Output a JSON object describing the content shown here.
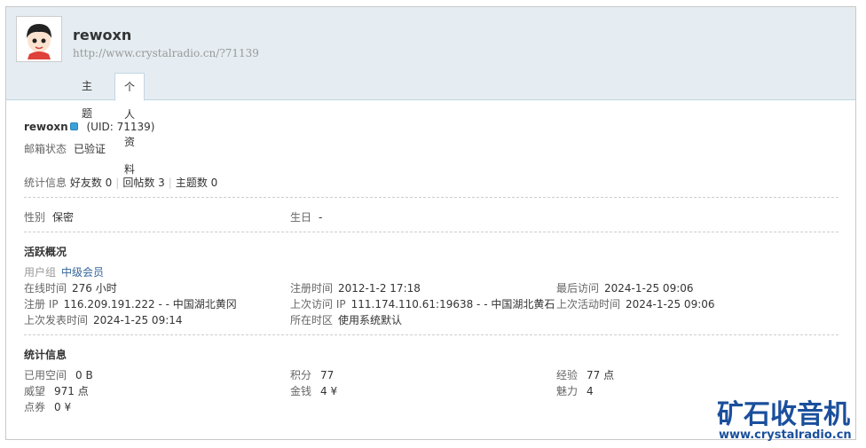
{
  "profile": {
    "username": "rewoxn",
    "url": "http://www.crystalradio.cn/?71139",
    "uid_text": "(UID: 71139)"
  },
  "tabs": [
    {
      "label": "主题"
    },
    {
      "label": "个人资料"
    }
  ],
  "basic": {
    "email_status_label": "邮箱状态",
    "email_status_value": "已验证",
    "stats_label": "统计信息",
    "friends": "好友数 0",
    "replies": "回帖数 3",
    "threads": "主题数 0",
    "gender_label": "性别",
    "gender_value": "保密",
    "birthday_label": "生日",
    "birthday_value": "-"
  },
  "activity": {
    "title": "活跃概况",
    "usergroup_label": "用户组",
    "usergroup_value": "中级会员",
    "online_label": "在线时间",
    "online_value": "276 小时",
    "reg_time_label": "注册时间",
    "reg_time_value": "2012-1-2 17:18",
    "last_visit_label": "最后访问",
    "last_visit_value": "2024-1-25 09:06",
    "reg_ip_label": "注册 IP",
    "reg_ip_value": "116.209.191.222 - - 中国湖北黄冈",
    "last_ip_label": "上次访问 IP",
    "last_ip_value": "111.174.110.61:19638 - - 中国湖北黄石",
    "last_active_label": "上次活动时间",
    "last_active_value": "2024-1-25 09:06",
    "last_post_label": "上次发表时间",
    "last_post_value": "2024-1-25 09:14",
    "timezone_label": "所在时区",
    "timezone_value": "使用系统默认"
  },
  "statistics": {
    "title": "统计信息",
    "space_label": "已用空间",
    "space_value": "0 B",
    "points_label": "积分",
    "points_value": "77",
    "exp_label": "经验",
    "exp_value": "77 点",
    "prestige_label": "威望",
    "prestige_value": "971 点",
    "money_label": "金钱",
    "money_value": "4 ¥",
    "charm_label": "魅力",
    "charm_value": "4",
    "coupon_label": "点券",
    "coupon_value": "0 ¥"
  },
  "watermark": {
    "title": "矿石收音机",
    "url": "www.crystalradio.cn"
  }
}
